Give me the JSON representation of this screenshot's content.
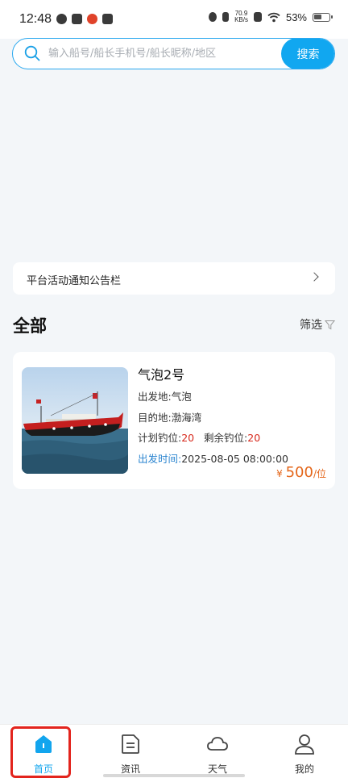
{
  "status_bar": {
    "time": "12:48",
    "network_speed_value": "70.9",
    "network_speed_unit": "KB/s",
    "battery_percent": "53%"
  },
  "search": {
    "placeholder": "输入船号/船长手机号/船长昵称/地区",
    "value": "",
    "button_label": "搜索"
  },
  "notice": {
    "label": "平台活动通知公告栏"
  },
  "section": {
    "title": "全部",
    "filter_label": "筛选"
  },
  "trips": [
    {
      "name": "气泡2号",
      "depart_label": "出发地:",
      "depart": "气泡",
      "dest_label": "目的地:",
      "dest": "渤海湾",
      "planned_label": "计划钓位:",
      "planned": "20",
      "remaining_label": "剩余钓位:",
      "remaining": "20",
      "time_label": "出发时间:",
      "time": "2025-08-05 08:00:00",
      "currency": "¥",
      "price": "500",
      "price_unit": "/位"
    }
  ],
  "tabs": [
    {
      "label": "首页",
      "icon": "home-icon",
      "active": true
    },
    {
      "label": "资讯",
      "icon": "document-icon",
      "active": false
    },
    {
      "label": "天气",
      "icon": "cloud-icon",
      "active": false
    },
    {
      "label": "我的",
      "icon": "user-icon",
      "active": false
    }
  ],
  "colors": {
    "accent": "#11a7f0",
    "price": "#e4661a",
    "highlight": "#e3241d",
    "seat_count": "#d7281c"
  }
}
